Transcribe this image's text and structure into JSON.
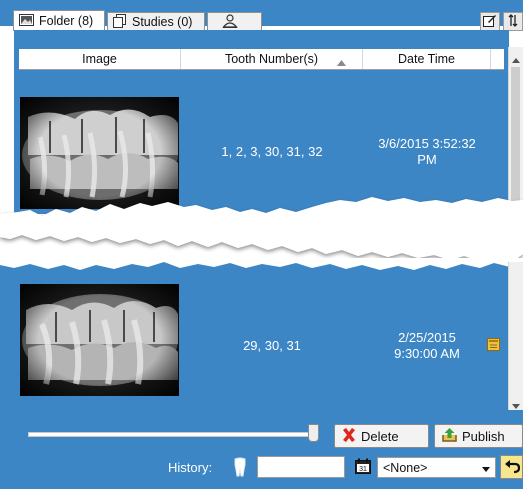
{
  "tabs": [
    {
      "label": "Folder (8)",
      "icon": "image-folder-icon"
    },
    {
      "label": "Studies (0)",
      "icon": "studies-icon"
    },
    {
      "label": "",
      "icon": "user-icon"
    }
  ],
  "toolbar": {
    "icons": [
      "edit-icon",
      "sort-icon"
    ]
  },
  "grid": {
    "headers": [
      "Image",
      "Tooth Number(s)",
      "Date Time"
    ],
    "sort_indicator": "ascending",
    "rows": [
      {
        "tooth_numbers": "1, 2, 3, 30, 31, 32",
        "date_time": "3/6/2015 3:52:32 PM"
      },
      {
        "tooth_numbers": "29, 30, 31",
        "date_time": "2/25/2015 9:30:00 AM"
      }
    ]
  },
  "actions": {
    "delete_label": "Delete",
    "publish_label": "Publish"
  },
  "history": {
    "label": "History:",
    "select_value": "<None>"
  },
  "colors": {
    "accent": "#3d86c5",
    "delete": "#e0261b",
    "note": "#f0c040"
  }
}
